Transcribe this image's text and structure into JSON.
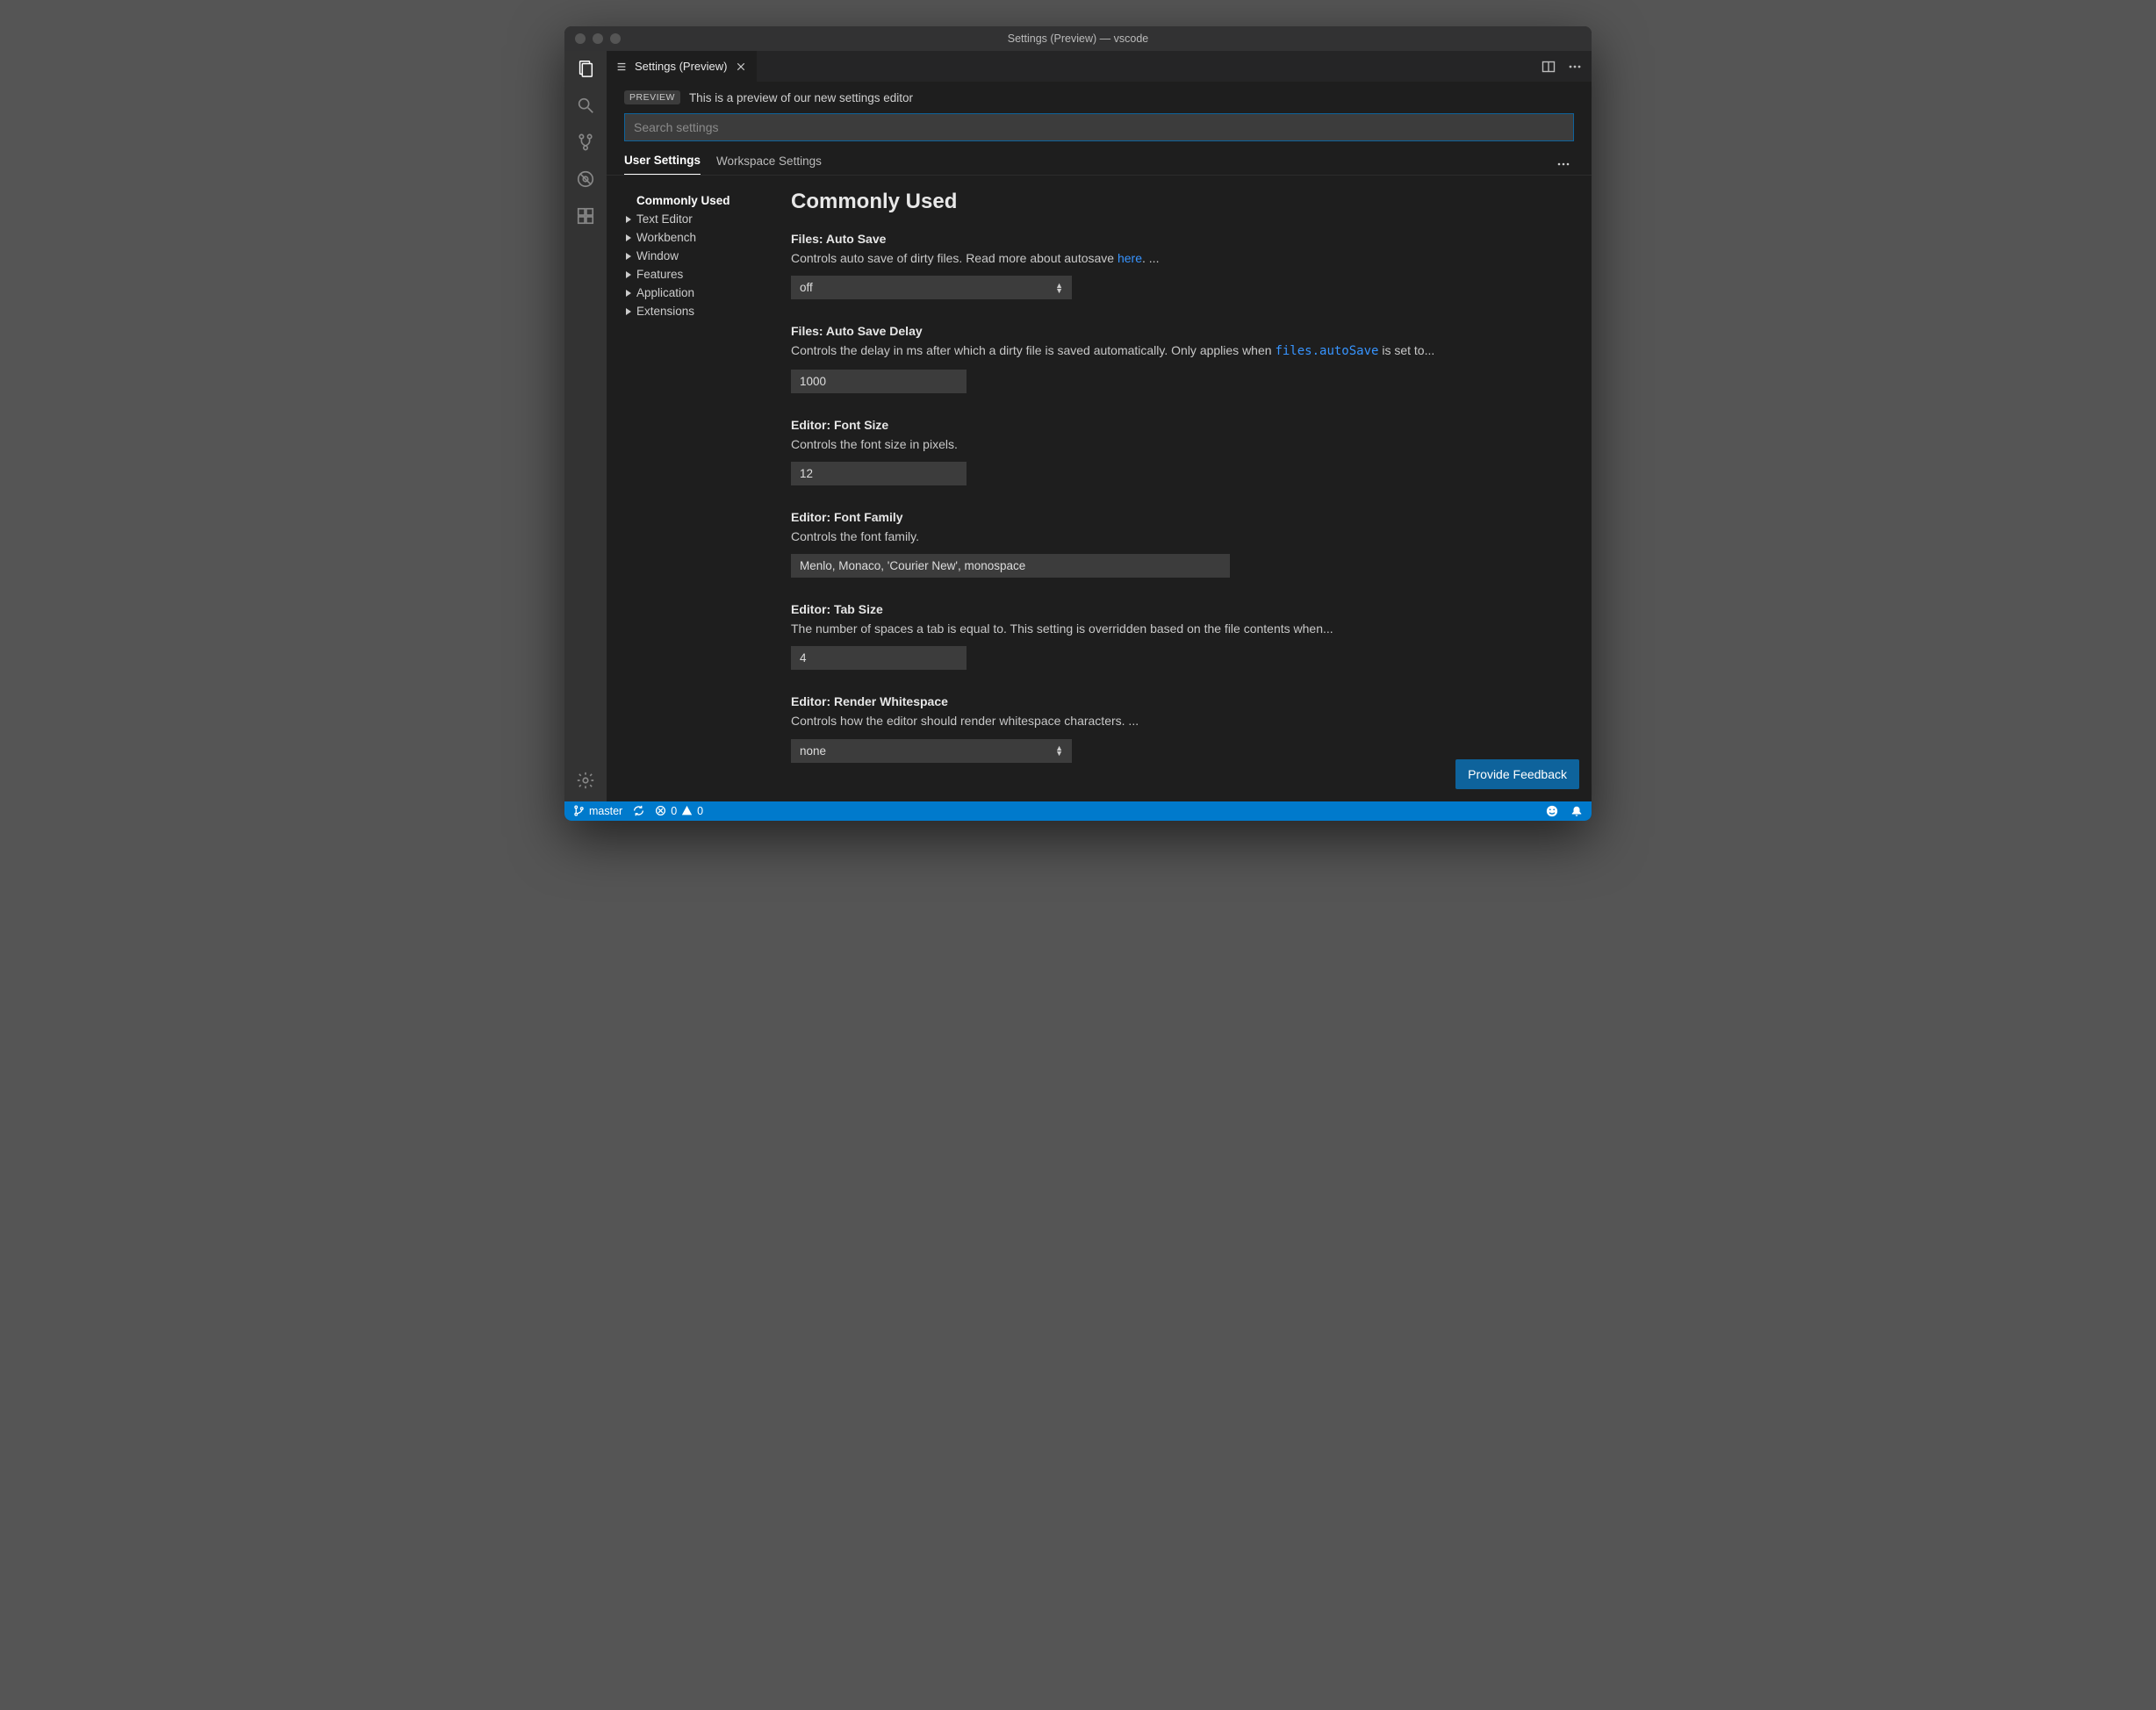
{
  "window": {
    "title": "Settings (Preview) — vscode"
  },
  "tab": {
    "label": "Settings (Preview)"
  },
  "preview": {
    "badge": "PREVIEW",
    "message": "This is a preview of our new settings editor"
  },
  "search": {
    "placeholder": "Search settings"
  },
  "scopeTabs": {
    "user": "User Settings",
    "workspace": "Workspace Settings"
  },
  "toc": {
    "items": [
      "Commonly Used",
      "Text Editor",
      "Workbench",
      "Window",
      "Features",
      "Application",
      "Extensions"
    ]
  },
  "section": {
    "heading": "Commonly Used"
  },
  "settings": {
    "autoSave": {
      "title": "Files: Auto Save",
      "desc1": "Controls auto save of dirty files. Read more about autosave ",
      "link": "here",
      "desc2": ". ...",
      "value": "off"
    },
    "autoSaveDelay": {
      "title": "Files: Auto Save Delay",
      "desc1": "Controls the delay in ms after which a dirty file is saved automatically. Only applies when ",
      "code": "files.autoSave",
      "desc2": " is set to...",
      "value": "1000"
    },
    "fontSize": {
      "title": "Editor: Font Size",
      "desc": "Controls the font size in pixels.",
      "value": "12"
    },
    "fontFamily": {
      "title": "Editor: Font Family",
      "desc": "Controls the font family.",
      "value": "Menlo, Monaco, 'Courier New', monospace"
    },
    "tabSize": {
      "title": "Editor: Tab Size",
      "desc": "The number of spaces a tab is equal to. This setting is overridden based on the file contents when...",
      "value": "4"
    },
    "renderWhitespace": {
      "title": "Editor: Render Whitespace",
      "desc": "Controls how the editor should render whitespace characters. ...",
      "value": "none"
    }
  },
  "feedback": {
    "label": "Provide Feedback"
  },
  "status": {
    "branch": "master",
    "errors": "0",
    "warnings": "0"
  }
}
